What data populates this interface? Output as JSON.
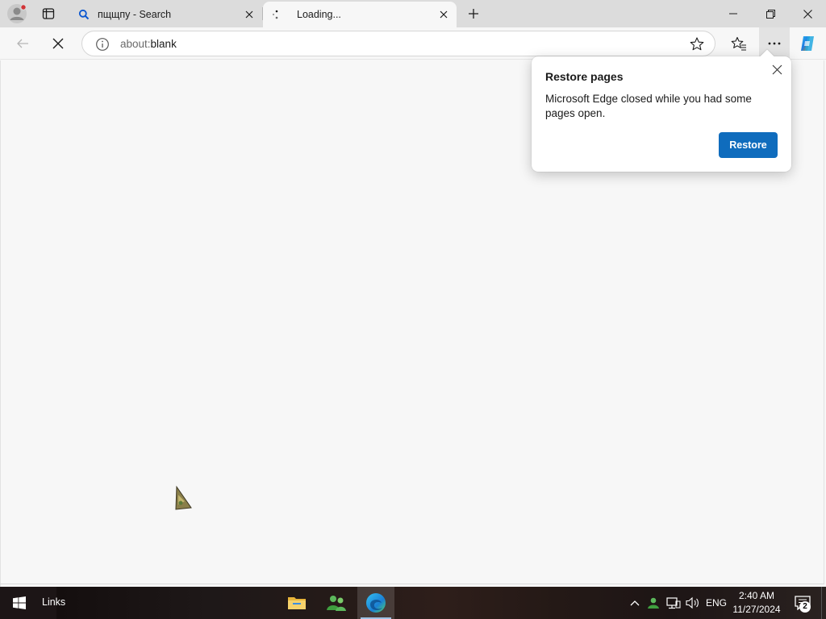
{
  "tabs": [
    {
      "title": "пщщпу - Search",
      "icon": "search-icon"
    },
    {
      "title": "Loading...",
      "icon": "loading-spinner-icon"
    }
  ],
  "address": {
    "scheme": "about:",
    "path": "blank"
  },
  "popup": {
    "title": "Restore pages",
    "message": "Microsoft Edge closed while you had some pages open.",
    "button": "Restore"
  },
  "taskbar": {
    "links_label": "Links",
    "language": "ENG",
    "time": "2:40 AM",
    "date": "11/27/2024",
    "notification_count": "2"
  },
  "colors": {
    "accent": "#0f6cbd",
    "search_icon": "#0b57d0"
  }
}
